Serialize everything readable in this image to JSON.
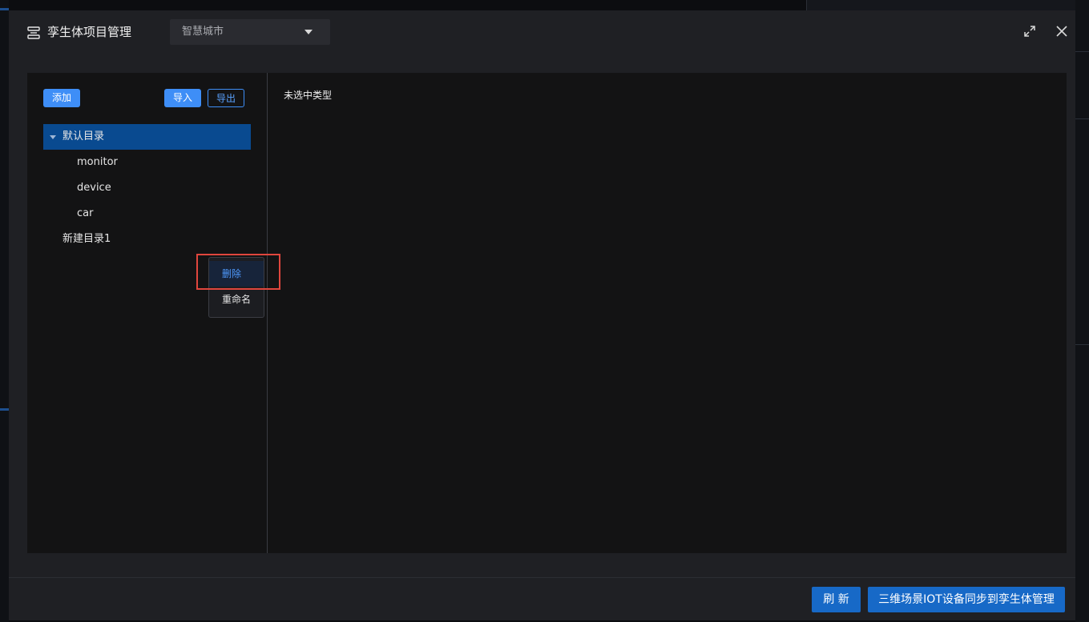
{
  "header": {
    "title": "孪生体项目管理",
    "project_select": {
      "value": "智慧城市"
    }
  },
  "toolbar": {
    "add_label": "添加",
    "import_label": "导入",
    "export_label": "导出"
  },
  "tree": {
    "items": [
      {
        "label": "默认目录",
        "selected": true,
        "expanded": true,
        "level": 0
      },
      {
        "label": "monitor",
        "level": 1
      },
      {
        "label": "device",
        "level": 1
      },
      {
        "label": "car",
        "level": 1
      },
      {
        "label": "新建目录1",
        "level": 0
      }
    ]
  },
  "context_menu": {
    "items": [
      {
        "label": "删除",
        "active": true
      },
      {
        "label": "重命名"
      }
    ]
  },
  "detail": {
    "empty_hint": "未选中类型"
  },
  "footer": {
    "refresh_label": "刷 新",
    "sync_label": "三维场景IOT设备同步到孪生体管理"
  },
  "colors": {
    "primary": "#3e8ef7",
    "selected_row": "#094a90",
    "footer_button": "#1769c7",
    "highlight": "#e0463d"
  }
}
